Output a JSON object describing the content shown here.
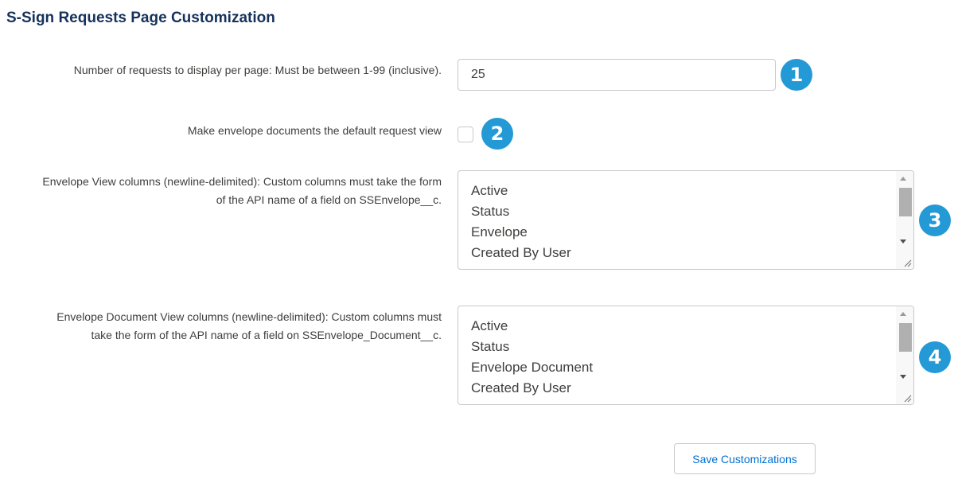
{
  "page": {
    "title": "S-Sign Requests Page Customization"
  },
  "fields": {
    "per_page": {
      "label": "Number of requests to display per page: Must be between 1-99 (inclusive).",
      "value": "25",
      "badge": "1"
    },
    "default_view": {
      "label": "Make envelope documents the default request view",
      "checked": false,
      "badge": "2"
    },
    "envelope_columns": {
      "label_line1": "Envelope View columns (newline-delimited): Custom columns must take the form",
      "label_line2": "of the API name of a field on SSEnvelope__c.",
      "lines": [
        "Active",
        "Status",
        "Envelope",
        "Created By User"
      ],
      "badge": "3"
    },
    "document_columns": {
      "label_line1": "Envelope Document View columns (newline-delimited): Custom columns must",
      "label_line2": "take the form of the API name of a field on SSEnvelope_Document__c.",
      "lines": [
        "Active",
        "Status",
        "Envelope Document",
        "Created By User"
      ],
      "badge": "4"
    }
  },
  "actions": {
    "save_label": "Save Customizations"
  },
  "colors": {
    "title": "#16325c",
    "badge": "#2399d6",
    "button_text": "#0070d2",
    "border": "#c9c9c9"
  },
  "icons": {
    "scroll_up": "triangle-up-icon",
    "scroll_down": "triangle-down-icon",
    "resize": "resize-grip-icon"
  }
}
